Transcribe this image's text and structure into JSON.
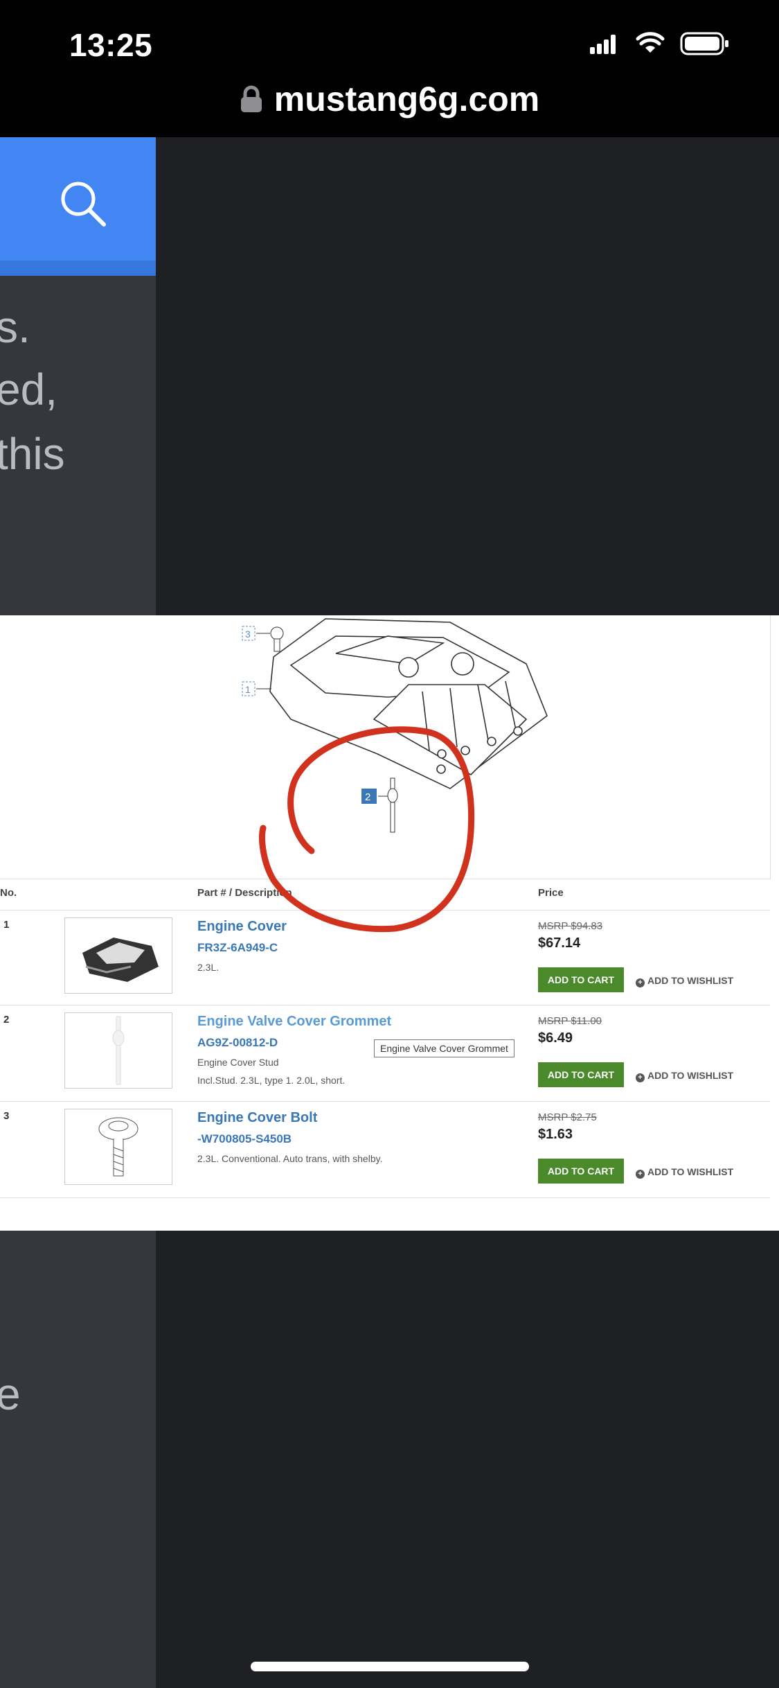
{
  "status_bar": {
    "time": "13:25",
    "url": "mustang6g.com"
  },
  "icons": {
    "lock": "lock-icon",
    "search": "search-icon",
    "signal": "signal-icon",
    "wifi": "wifi-icon",
    "battery": "battery-icon"
  },
  "background_text": {
    "line1": "s.",
    "line2": "ed,",
    "line3": "this",
    "line4": "e"
  },
  "diagram": {
    "callouts": [
      "3",
      "1",
      "2"
    ]
  },
  "table": {
    "headers": {
      "no": "No.",
      "part": "Part # / Description",
      "price": "Price"
    },
    "rows": [
      {
        "num": "1",
        "title": "Engine Cover",
        "part_no": "FR3Z-6A949-C",
        "desc1": "2.3L.",
        "desc2": "",
        "msrp": "MSRP $94.83",
        "price": "$67.14",
        "cart": "ADD TO CART",
        "wishlist": "ADD TO WISHLIST"
      },
      {
        "num": "2",
        "title": "Engine Valve Cover Grommet",
        "part_no": "AG9Z-00812-D",
        "desc1": "Engine Cover Stud",
        "desc2": "Incl.Stud. 2.3L, type 1. 2.0L, short.",
        "msrp": "MSRP $11.00",
        "price": "$6.49",
        "cart": "ADD TO CART",
        "wishlist": "ADD TO WISHLIST"
      },
      {
        "num": "3",
        "title": "Engine Cover Bolt",
        "part_no": "-W700805-S450B",
        "desc1": "2.3L. Conventional. Auto trans, with shelby.",
        "desc2": "",
        "msrp": "MSRP $2.75",
        "price": "$1.63",
        "cart": "ADD TO CART",
        "wishlist": "ADD TO WISHLIST"
      }
    ],
    "tooltip": "Engine Valve Cover Grommet"
  },
  "colors": {
    "accent_blue": "#4286f4",
    "link_blue": "#3a77b5",
    "cart_green": "#4a8a2a",
    "annotation_red": "#d0321e"
  }
}
